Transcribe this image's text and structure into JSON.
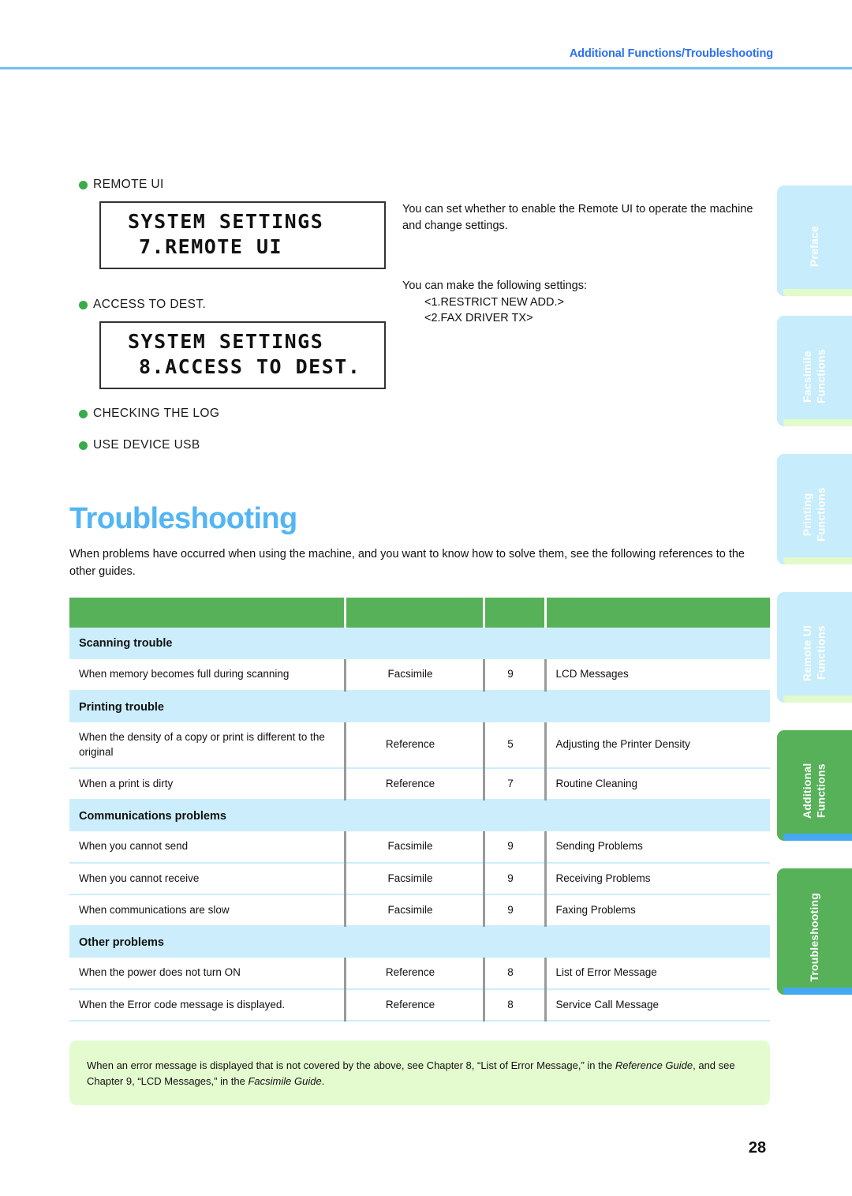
{
  "header": {
    "title": "Additional Functions/Troubleshooting"
  },
  "settings": {
    "items": [
      {
        "label": "REMOTE UI"
      },
      {
        "label": "ACCESS TO DEST."
      },
      {
        "label": "CHECKING THE LOG"
      },
      {
        "label": "USE DEVICE USB"
      }
    ],
    "lcd_remote_ui": {
      "line1": "SYSTEM SETTINGS",
      "line2": "7.REMOTE UI"
    },
    "lcd_access_to_dest": {
      "line1": "SYSTEM SETTINGS",
      "line2": "8.ACCESS TO DEST."
    },
    "explanation_1": "You can set whether to enable the Remote UI to operate the machine and change settings.",
    "explanation_2": "You can make the following settings:",
    "setting_option_1": "<1.RESTRICT NEW ADD.>",
    "setting_option_2": "<2.FAX DRIVER TX>"
  },
  "troubleshooting": {
    "title": "Troubleshooting",
    "intro": "When problems have occurred when using the machine, and you want to know how to solve them, see the following references to the other guides.",
    "table": {
      "headers": [
        "",
        "",
        "",
        ""
      ],
      "groups": [
        {
          "name": "Scanning trouble",
          "rows": [
            {
              "problem": "When memory becomes full during scanning",
              "guide": "Facsimile",
              "chapter": "9",
              "topic": "LCD Messages"
            }
          ]
        },
        {
          "name": "Printing trouble",
          "rows": [
            {
              "problem": "When the density of a copy or print is different to the original",
              "guide": "Reference",
              "chapter": "5",
              "topic": "Adjusting the Printer Density"
            },
            {
              "problem": "When a print is dirty",
              "guide": "Reference",
              "chapter": "7",
              "topic": "Routine Cleaning"
            }
          ]
        },
        {
          "name": "Communications problems",
          "rows": [
            {
              "problem": "When you cannot send",
              "guide": "Facsimile",
              "chapter": "9",
              "topic": "Sending Problems"
            },
            {
              "problem": "When you cannot receive",
              "guide": "Facsimile",
              "chapter": "9",
              "topic": "Receiving Problems"
            },
            {
              "problem": "When communications are slow",
              "guide": "Facsimile",
              "chapter": "9",
              "topic": "Faxing Problems"
            }
          ]
        },
        {
          "name": "Other problems",
          "rows": [
            {
              "problem": "When the power does not turn ON",
              "guide": "Reference",
              "chapter": "8",
              "topic": "List of Error Message"
            },
            {
              "problem": "When the Error code message is displayed.",
              "guide": "Reference",
              "chapter": "8",
              "topic": "Service Call Message"
            }
          ]
        }
      ]
    },
    "note": {
      "part1": "When an error message is displayed that is not covered by the above, see Chapter 8, “List of Error Message,” in the ",
      "italic1": "Reference Guide",
      "part2": ", and see Chapter 9, “LCD Messages,” in the ",
      "italic2": "Facsimile Guide",
      "part3": "."
    }
  },
  "side_tabs": [
    {
      "label": "Preface",
      "state": "inactive"
    },
    {
      "label": "Facsimile\nFunctions",
      "state": "inactive"
    },
    {
      "label": "Printing\nFunctions",
      "state": "inactive"
    },
    {
      "label": "Remote UI\nFunctions",
      "state": "inactive"
    },
    {
      "label": "Additional\nFunctions",
      "state": "active"
    },
    {
      "label": "Troubleshooting",
      "state": "active"
    }
  ],
  "page_number": "28",
  "colors": {
    "accent_blue": "#53b5f4",
    "header_blue": "#2a6ff5",
    "table_green": "#57b159",
    "row_light_blue": "#cceefc",
    "note_green": "#e4fbd0",
    "bullet_green": "#3aab4b",
    "tab_inactive": "#c7ecfb",
    "tab_active_underline": "#46a8f0"
  }
}
